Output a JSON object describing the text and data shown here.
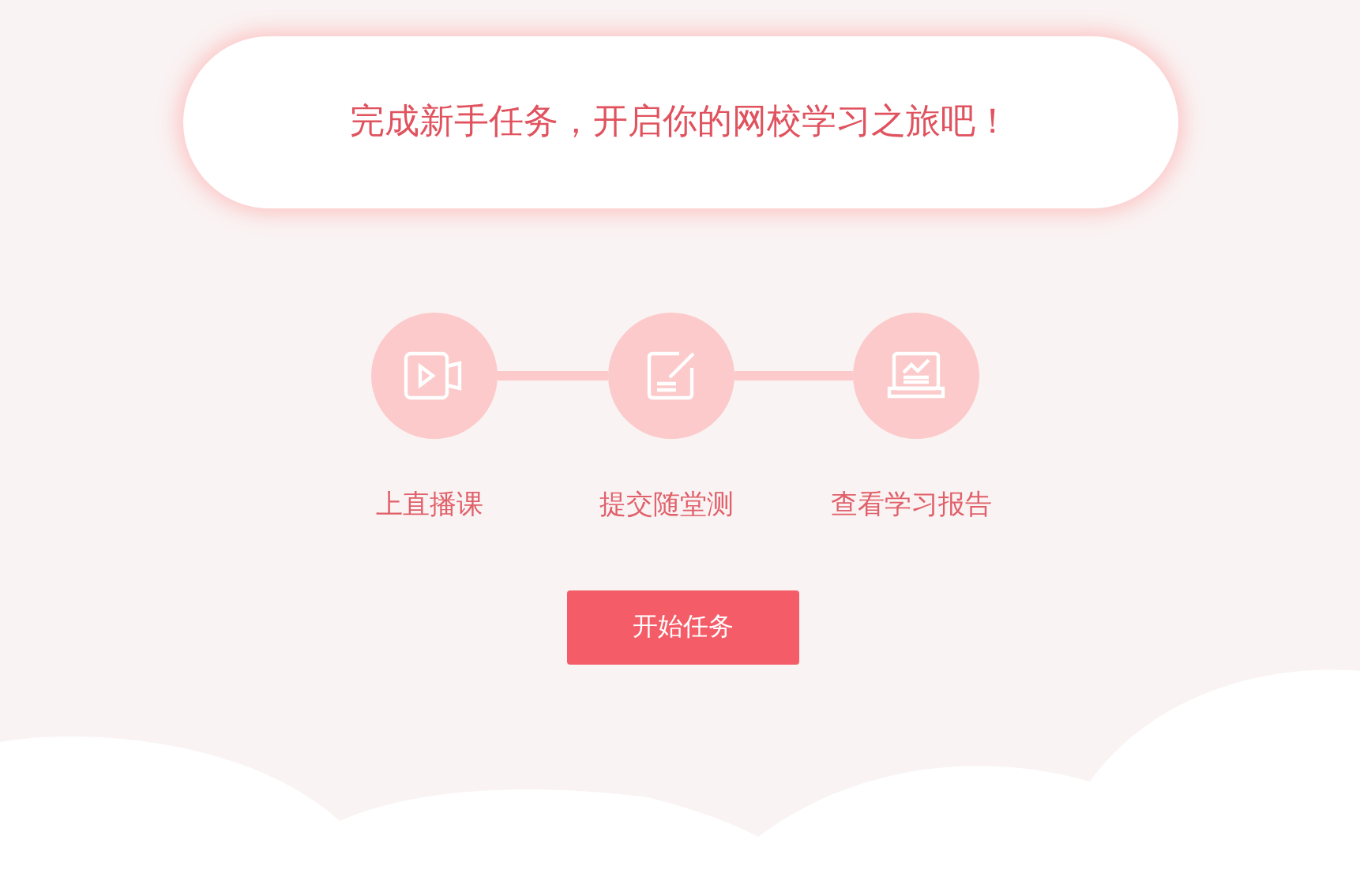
{
  "banner": {
    "text": "完成新手任务，开启你的网校学习之旅吧！"
  },
  "steps": [
    {
      "kind": "video",
      "label": "上直播课"
    },
    {
      "kind": "edit",
      "label": "提交随堂测"
    },
    {
      "kind": "report",
      "label": "查看学习报告"
    }
  ],
  "start_button": {
    "label": "开始任务"
  }
}
